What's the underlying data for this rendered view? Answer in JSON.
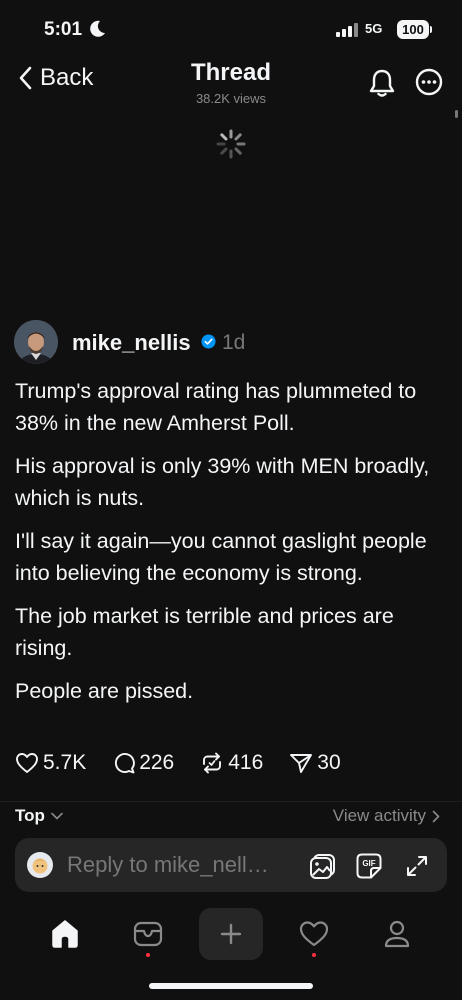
{
  "status_bar": {
    "time": "5:01",
    "network": "5G",
    "battery": "100"
  },
  "header": {
    "back_label": "Back",
    "title": "Thread",
    "views": "38.2K views"
  },
  "post": {
    "username": "mike_nellis",
    "time": "1d",
    "paragraphs": [
      "Trump's approval rating has plummeted to 38% in the new Amherst Poll.",
      "His approval is only 39% with MEN broadly, which is nuts.",
      "I'll say it again—you cannot gaslight people into believing the economy is strong.",
      "The job market is terrible and prices are rising.",
      "People are pissed."
    ],
    "likes": "5.7K",
    "replies": "226",
    "reposts": "416",
    "shares": "30"
  },
  "replies_section": {
    "sort_label": "Top",
    "activity_label": "View activity"
  },
  "reply_bar": {
    "placeholder": "Reply to mike_nell…",
    "gif_label": "GIF"
  },
  "colors": {
    "background": "#101010",
    "text": "#f3f5f7",
    "muted": "#777777",
    "verified": "#0095f6",
    "notification_dot": "#ff3040"
  },
  "icons": [
    "moon-icon",
    "signal-icon",
    "chevron-left-icon",
    "bell-icon",
    "more-icon",
    "loading-spinner",
    "verified-icon",
    "heart-icon",
    "comment-icon",
    "repost-icon",
    "share-icon",
    "chevron-down-icon",
    "chevron-right-icon",
    "image-icon",
    "gif-icon",
    "expand-icon",
    "home-icon",
    "inbox-icon",
    "plus-icon",
    "activity-icon",
    "profile-icon"
  ]
}
